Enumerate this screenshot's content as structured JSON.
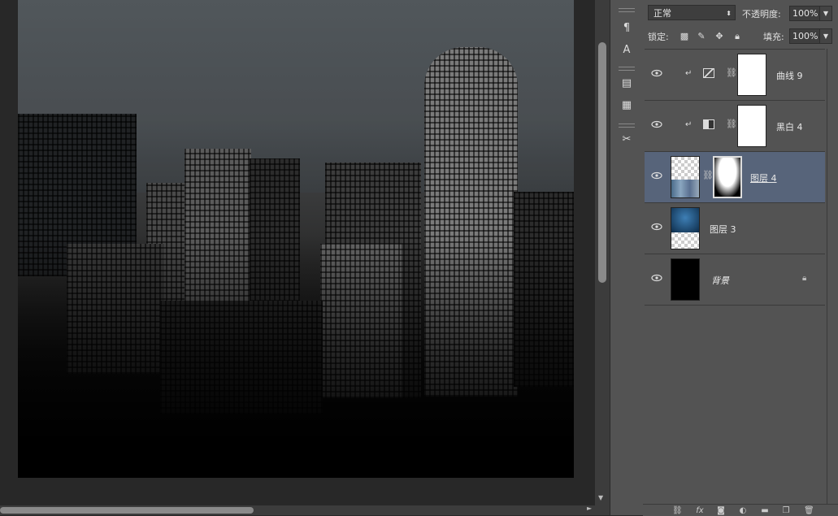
{
  "layers_panel": {
    "blend_mode": "正常",
    "opacity_label": "不透明度:",
    "opacity_value": "100%",
    "lock_label": "锁定:",
    "fill_label": "填充:",
    "fill_value": "100%",
    "layers": [
      {
        "name": "曲线 9",
        "type": "adjustment-curves",
        "clipped": true,
        "selected": false
      },
      {
        "name": "黑白 4",
        "type": "adjustment-black-white",
        "clipped": true,
        "selected": false
      },
      {
        "name": "图层 4",
        "type": "pixel-with-mask",
        "clipped": false,
        "selected": true
      },
      {
        "name": "图层 3",
        "type": "pixel",
        "clipped": false,
        "selected": false
      },
      {
        "name": "背景",
        "type": "background",
        "locked": true,
        "selected": false
      }
    ]
  },
  "toolstrip": {
    "icons": [
      "paragraph-style-icon",
      "character-style-icon",
      "history-icon",
      "notes-icon",
      "tool-presets-icon"
    ]
  },
  "bottom_bar": {
    "icons": [
      "link-layers-icon",
      "fx-icon",
      "add-mask-icon",
      "new-adjustment-icon",
      "new-group-icon",
      "new-layer-icon",
      "delete-layer-icon"
    ]
  },
  "colors": {
    "panel_bg": "#535353",
    "selected_layer": "#57647a",
    "canvas_bg": "#282828"
  }
}
